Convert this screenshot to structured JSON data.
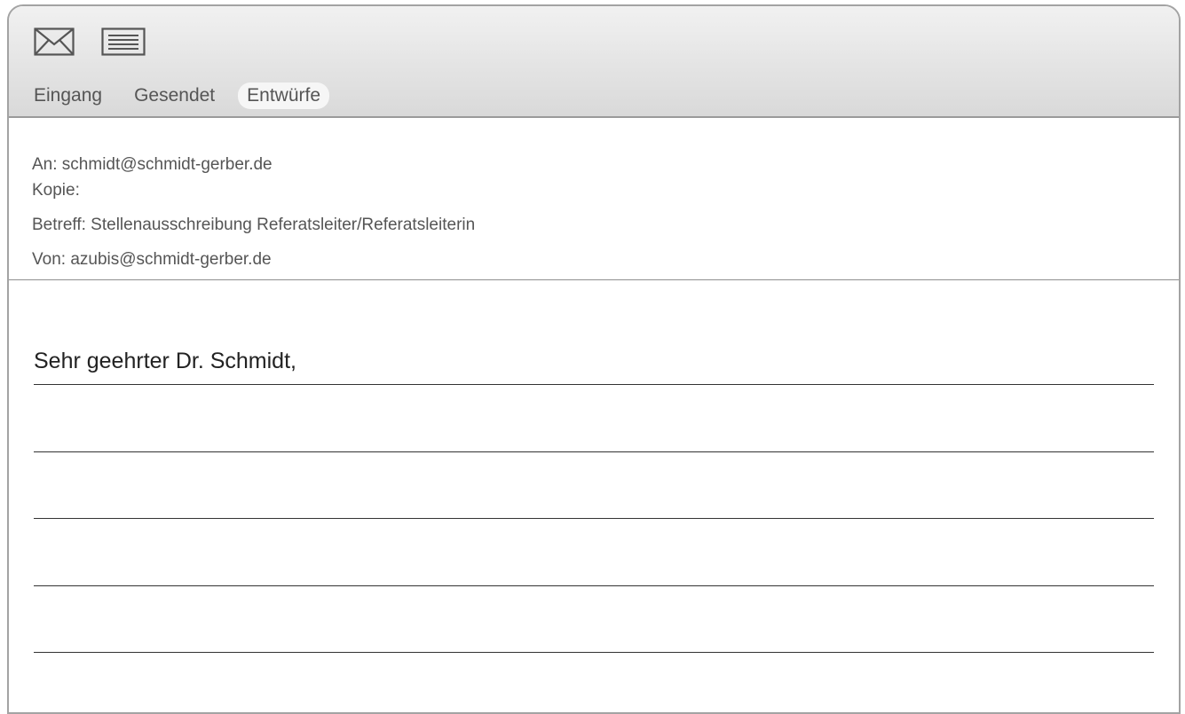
{
  "toolbar": {
    "icons": [
      "envelope-icon",
      "list-icon"
    ],
    "tabs": [
      {
        "label": "Eingang",
        "active": false
      },
      {
        "label": "Gesendet",
        "active": false
      },
      {
        "label": "Entwürfe",
        "active": true
      }
    ]
  },
  "header": {
    "to": "An: schmidt@schmidt-gerber.de",
    "cc": "Kopie:",
    "subject": "Betreff: Stellenausschreibung Referatsleiter/Referatsleiterin",
    "from": "Von: azubis@schmidt-gerber.de"
  },
  "body": {
    "greeting": "Sehr geehrter Dr. Schmidt,"
  },
  "colors": {
    "toolbar_top": "#f1f1f1",
    "toolbar_bottom": "#d9d9d9",
    "border": "#a3a3a3",
    "active_tab": "#f6f6f6"
  }
}
